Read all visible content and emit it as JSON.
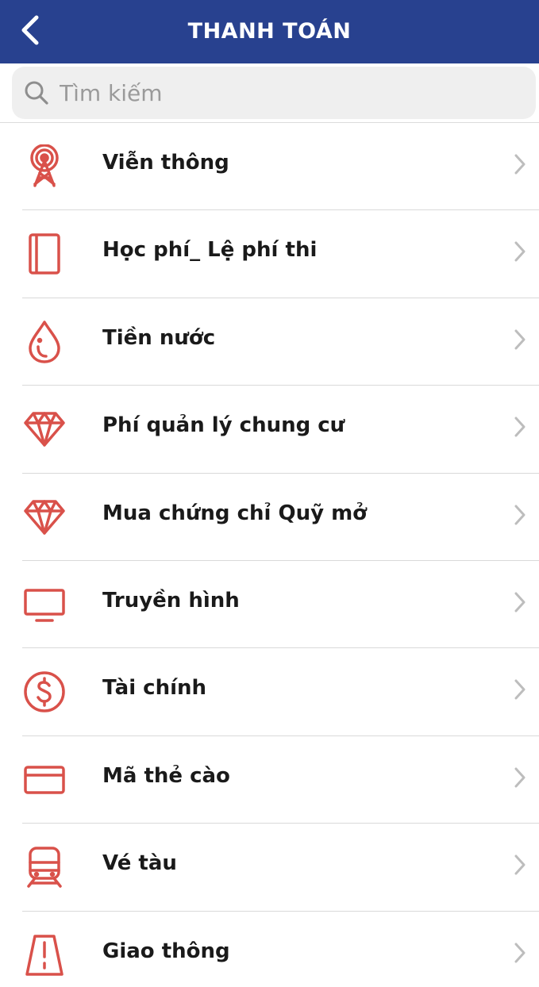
{
  "header": {
    "title": "THANH TOÁN",
    "background": "#28418f"
  },
  "search": {
    "placeholder": "Tìm kiếm",
    "value": ""
  },
  "accent_color": "#d9514a",
  "items": [
    {
      "label": "Viễn thông",
      "icon": "antenna-tower-icon"
    },
    {
      "label": "Học phí_ Lệ phí thi",
      "icon": "book-icon"
    },
    {
      "label": "Tiền nước",
      "icon": "water-drop-icon"
    },
    {
      "label": "Phí quản lý chung cư",
      "icon": "diamond-icon"
    },
    {
      "label": "Mua chứng chỉ Quỹ mở",
      "icon": "diamond-icon"
    },
    {
      "label": "Truyền hình",
      "icon": "tv-icon"
    },
    {
      "label": "Tài chính",
      "icon": "dollar-circle-icon"
    },
    {
      "label": "Mã thẻ cào",
      "icon": "card-icon"
    },
    {
      "label": "Vé tàu",
      "icon": "train-icon"
    },
    {
      "label": "Giao thông",
      "icon": "road-icon"
    }
  ]
}
